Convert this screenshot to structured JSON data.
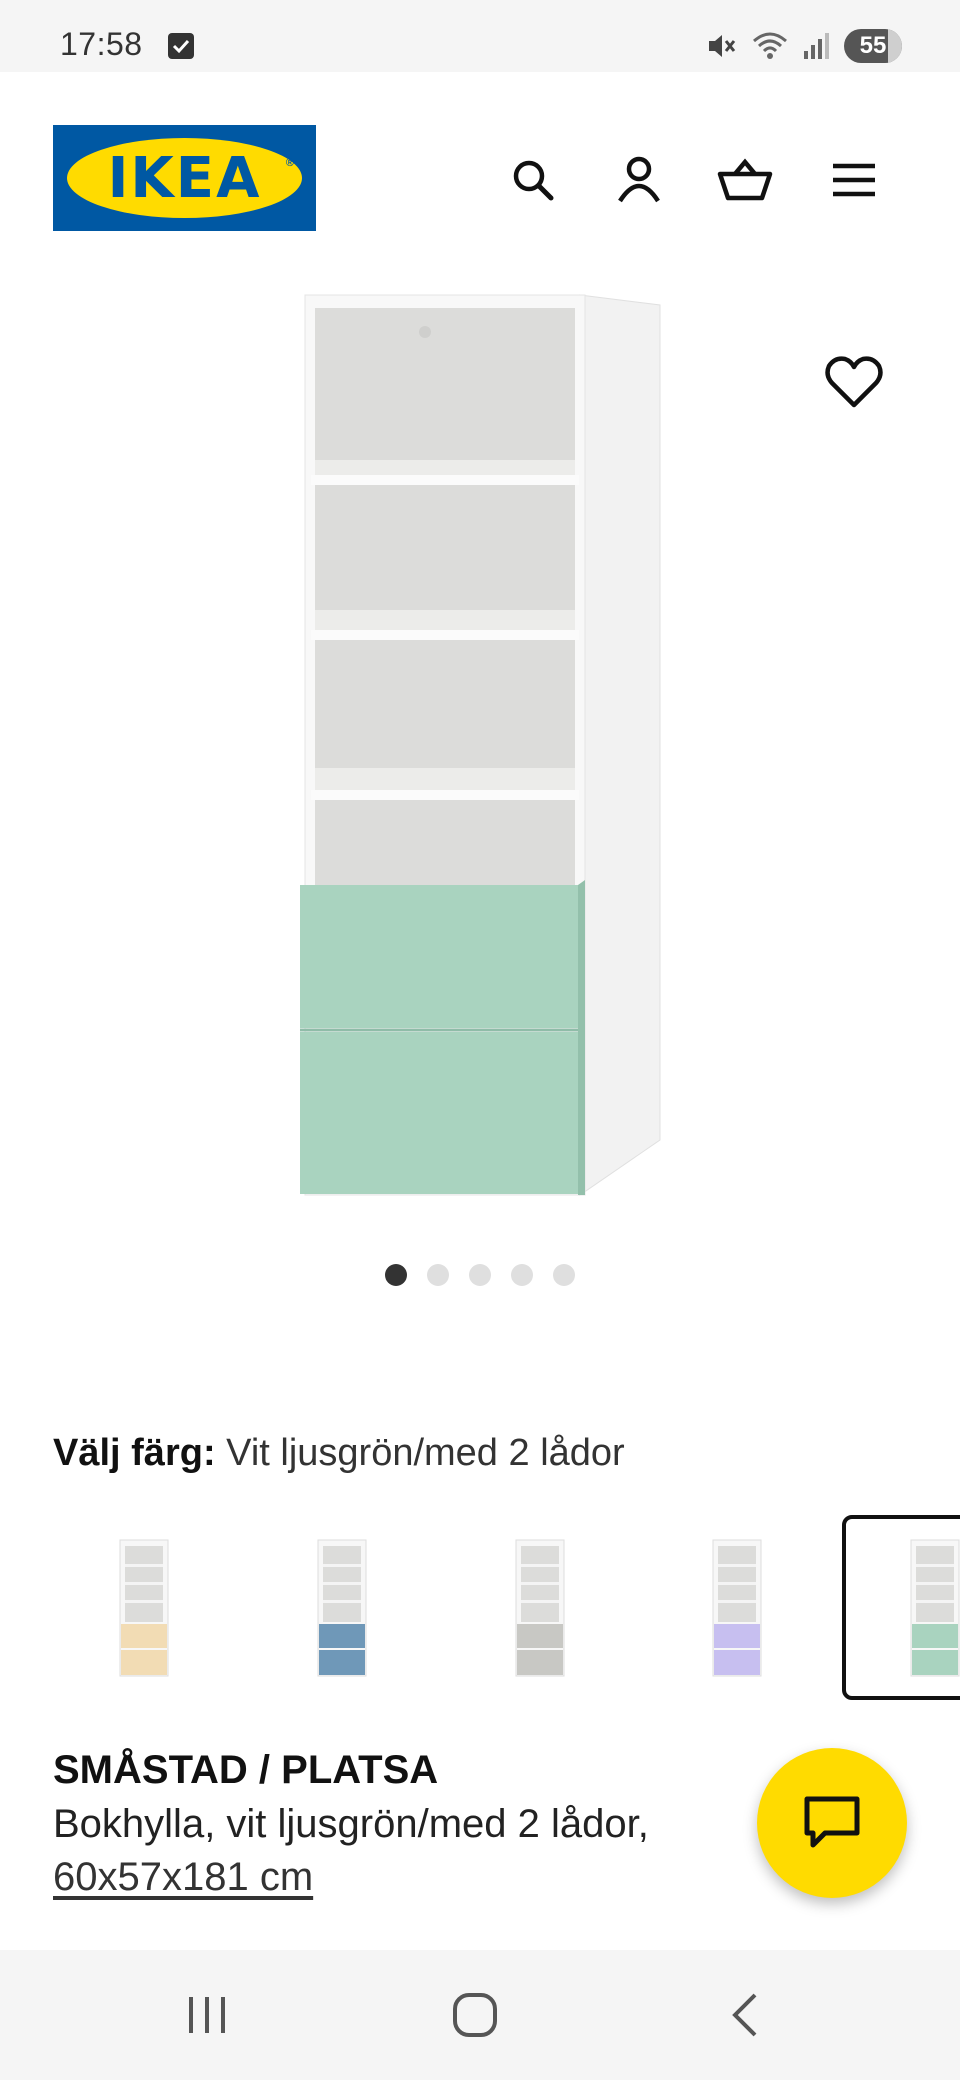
{
  "status_bar": {
    "time": "17:58",
    "battery": "55",
    "icons": [
      "checkbox-icon",
      "mute-icon",
      "wifi-icon",
      "signal-icon",
      "battery-icon"
    ]
  },
  "header": {
    "logo_text": "IKEA",
    "logo_reg": "®",
    "icons": [
      "search-icon",
      "account-icon",
      "cart-icon",
      "menu-icon"
    ]
  },
  "gallery": {
    "image_count": 5,
    "active_index": 0
  },
  "color_selector": {
    "label": "Välj färg:",
    "value": "Vit ljusgrön/med 2 lådor",
    "swatches": [
      {
        "color": "#f2dcb4",
        "selected": false
      },
      {
        "color": "#6f98b8",
        "selected": false
      },
      {
        "color": "#c8c8c4",
        "selected": false
      },
      {
        "color": "#c7bff0",
        "selected": false
      },
      {
        "color": "#a9d3bf",
        "selected": true
      }
    ]
  },
  "product": {
    "name": "SMÅSTAD / PLATSA",
    "description": "Bokhylla, vit ljusgrön/med 2 lådor,",
    "dimensions": "60x57x181 cm"
  },
  "colors": {
    "brand_blue": "#0058a3",
    "brand_yellow": "#ffdb00",
    "drawer_green": "#a9d3bf"
  }
}
